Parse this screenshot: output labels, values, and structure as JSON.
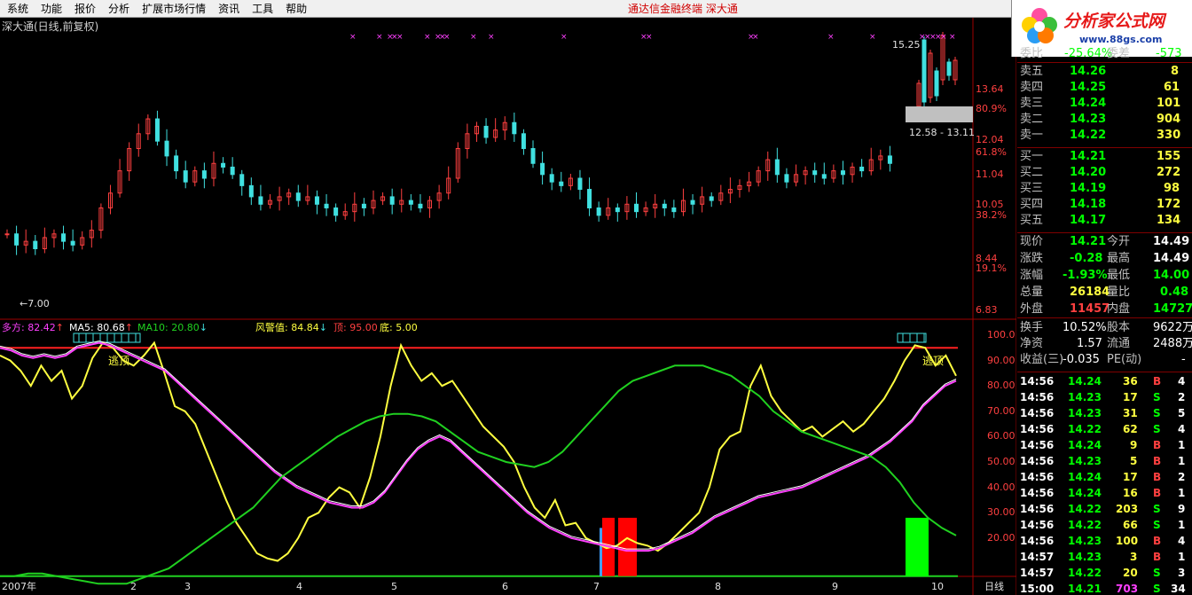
{
  "menu": {
    "items": [
      "系统",
      "功能",
      "报价",
      "分析",
      "扩展市场行情",
      "资讯",
      "工具",
      "帮助"
    ],
    "title": "通达信金融终端   深大通"
  },
  "logo": {
    "brand": "分析家公式网",
    "url": "www.88gs.com"
  },
  "chart": {
    "title": "深大通(日线,前复权)",
    "price_axis": [
      "13.64",
      "80.9%",
      "12.04",
      "61.8%",
      "11.04",
      "10.05",
      "38.2%",
      "8.44",
      "19.1%",
      "6.83"
    ],
    "high_label": "15.25",
    "low_label": "←7.00",
    "range_label": "12.58 - 13.11",
    "months": [
      "2007年",
      "2",
      "3",
      "4",
      "5",
      "6",
      "7",
      "8",
      "9",
      "10"
    ],
    "period": "日线",
    "colors": {
      "up": "#ff4040",
      "down": "#40e0e0",
      "yellow": "#ffff40",
      "magenta": "#ff40ff",
      "green": "#20d020",
      "red_bar": "#ff0000",
      "green_bar": "#00ff00"
    }
  },
  "indicator": {
    "duofang": "多方: 82.42",
    "ma5": "MA5: 80.68",
    "ma10": "MA10: 20.80",
    "fengjing": "风警值: 84.84",
    "ding": "顶: 95.00",
    "di": "底: 5.00",
    "escape_label": "逃顶",
    "axis": [
      "100.0",
      "90.00",
      "80.00",
      "70.00",
      "60.00",
      "50.00",
      "40.00",
      "30.00",
      "20.00"
    ]
  },
  "chart_data": {
    "type": "line",
    "y_axis": {
      "min": 0,
      "max": 100,
      "ticks": [
        "100.0",
        "90.00",
        "80.00",
        "70.00",
        "60.00",
        "50.00",
        "40.00",
        "30.00",
        "20.00"
      ]
    },
    "series": [
      {
        "name": "多方",
        "color": "#ffff40",
        "y": [
          92,
          90,
          86,
          80,
          88,
          82,
          86,
          75,
          80,
          91,
          97,
          95,
          90,
          88,
          92,
          97,
          85,
          72,
          70,
          65,
          55,
          45,
          35,
          26,
          20,
          14,
          12,
          11,
          14,
          20,
          28,
          30,
          36,
          40,
          38,
          32,
          44,
          60,
          80,
          96,
          88,
          82,
          85,
          80,
          82,
          76,
          70,
          64,
          60,
          56,
          50,
          40,
          32,
          28,
          35,
          25,
          26,
          20,
          18,
          16,
          17,
          20,
          18,
          17,
          15,
          18,
          22,
          26,
          30,
          40,
          55,
          60,
          62,
          80,
          88,
          76,
          70,
          66,
          62,
          64,
          60,
          63,
          66,
          62,
          65,
          70,
          75,
          82,
          90,
          96,
          95,
          88,
          92,
          84
        ]
      },
      {
        "name": "MA5",
        "color": "#ff40ff",
        "y": [
          95,
          94,
          92,
          91,
          92,
          91,
          92,
          95,
          96,
          97,
          96,
          94,
          92,
          90,
          88,
          86,
          82,
          78,
          74,
          70,
          66,
          62,
          58,
          54,
          50,
          46,
          43,
          40,
          38,
          36,
          34,
          33,
          32,
          32,
          34,
          38,
          44,
          50,
          55,
          58,
          60,
          58,
          54,
          50,
          46,
          42,
          38,
          34,
          30,
          27,
          24,
          22,
          20,
          19,
          18,
          17,
          16,
          15,
          15,
          15,
          16,
          18,
          20,
          22,
          25,
          28,
          30,
          32,
          34,
          36,
          37,
          38,
          39,
          40,
          42,
          44,
          46,
          48,
          50,
          52,
          55,
          58,
          62,
          66,
          72,
          76,
          80,
          82
        ]
      },
      {
        "name": "MA10",
        "color": "#20d020",
        "y": [
          5,
          5,
          6,
          6,
          5,
          4,
          3,
          2,
          2,
          2,
          4,
          6,
          8,
          12,
          16,
          20,
          24,
          28,
          32,
          38,
          44,
          48,
          52,
          56,
          60,
          63,
          66,
          68,
          69,
          69,
          68,
          66,
          62,
          58,
          54,
          52,
          50,
          49,
          48,
          50,
          54,
          60,
          66,
          72,
          78,
          82,
          84,
          86,
          88,
          88,
          88,
          86,
          84,
          80,
          76,
          70,
          66,
          62,
          60,
          58,
          56,
          54,
          52,
          48,
          42,
          34,
          28,
          24,
          21
        ]
      }
    ],
    "thresholds": {
      "top": 95.0,
      "bottom": 5.0
    }
  },
  "quote": {
    "header_label": "委比",
    "header_value": "-25.64%",
    "header_label2": "委差",
    "header_value2": "-573",
    "sells": [
      {
        "label": "卖五",
        "price": "14.26",
        "vol": "8"
      },
      {
        "label": "卖四",
        "price": "14.25",
        "vol": "61"
      },
      {
        "label": "卖三",
        "price": "14.24",
        "vol": "101"
      },
      {
        "label": "卖二",
        "price": "14.23",
        "vol": "904"
      },
      {
        "label": "卖一",
        "price": "14.22",
        "vol": "330"
      }
    ],
    "buys": [
      {
        "label": "买一",
        "price": "14.21",
        "vol": "155"
      },
      {
        "label": "买二",
        "price": "14.20",
        "vol": "272"
      },
      {
        "label": "买三",
        "price": "14.19",
        "vol": "98"
      },
      {
        "label": "买四",
        "price": "14.18",
        "vol": "172"
      },
      {
        "label": "买五",
        "price": "14.17",
        "vol": "134"
      }
    ],
    "stats": [
      {
        "l1": "现价",
        "v1": "14.21",
        "c1": "#00ff00",
        "l2": "今开",
        "v2": "14.49",
        "c2": "#ffffff"
      },
      {
        "l1": "涨跌",
        "v1": "-0.28",
        "c1": "#00ff00",
        "l2": "最高",
        "v2": "14.49",
        "c2": "#ffffff"
      },
      {
        "l1": "涨幅",
        "v1": "-1.93%",
        "c1": "#00ff00",
        "l2": "最低",
        "v2": "14.00",
        "c2": "#00ff00"
      },
      {
        "l1": "总量",
        "v1": "26184",
        "c1": "#ffff40",
        "l2": "量比",
        "v2": "0.48",
        "c2": "#00ff00"
      },
      {
        "l1": "外盘",
        "v1": "11457",
        "c1": "#ff4040",
        "l2": "内盘",
        "v2": "14727",
        "c2": "#00ff00"
      }
    ],
    "stats2": [
      {
        "l1": "换手",
        "v1": "10.52%",
        "l2": "股本",
        "v2": "9622万"
      },
      {
        "l1": "净资",
        "v1": "1.57",
        "l2": "流通",
        "v2": "2488万"
      },
      {
        "l1": "收益(三)",
        "v1": "-0.035",
        "l2": "PE(动)",
        "v2": "-"
      }
    ]
  },
  "ticks": [
    {
      "t": "14:56",
      "p": "14.24",
      "v": "36",
      "s": "B",
      "n": "4"
    },
    {
      "t": "14:56",
      "p": "14.23",
      "v": "17",
      "s": "S",
      "n": "2"
    },
    {
      "t": "14:56",
      "p": "14.23",
      "v": "31",
      "s": "S",
      "n": "5"
    },
    {
      "t": "14:56",
      "p": "14.22",
      "v": "62",
      "s": "S",
      "n": "4"
    },
    {
      "t": "14:56",
      "p": "14.24",
      "v": "9",
      "s": "B",
      "n": "1"
    },
    {
      "t": "14:56",
      "p": "14.23",
      "v": "5",
      "s": "B",
      "n": "1"
    },
    {
      "t": "14:56",
      "p": "14.24",
      "v": "17",
      "s": "B",
      "n": "2"
    },
    {
      "t": "14:56",
      "p": "14.24",
      "v": "16",
      "s": "B",
      "n": "1"
    },
    {
      "t": "14:56",
      "p": "14.22",
      "v": "203",
      "s": "S",
      "n": "9"
    },
    {
      "t": "14:56",
      "p": "14.22",
      "v": "66",
      "s": "S",
      "n": "1"
    },
    {
      "t": "14:56",
      "p": "14.23",
      "v": "100",
      "s": "B",
      "n": "4"
    },
    {
      "t": "14:57",
      "p": "14.23",
      "v": "3",
      "s": "B",
      "n": "1"
    },
    {
      "t": "14:57",
      "p": "14.22",
      "v": "20",
      "s": "S",
      "n": "3"
    },
    {
      "t": "15:00",
      "p": "14.21",
      "v": "703",
      "s": "S",
      "n": "34"
    }
  ]
}
